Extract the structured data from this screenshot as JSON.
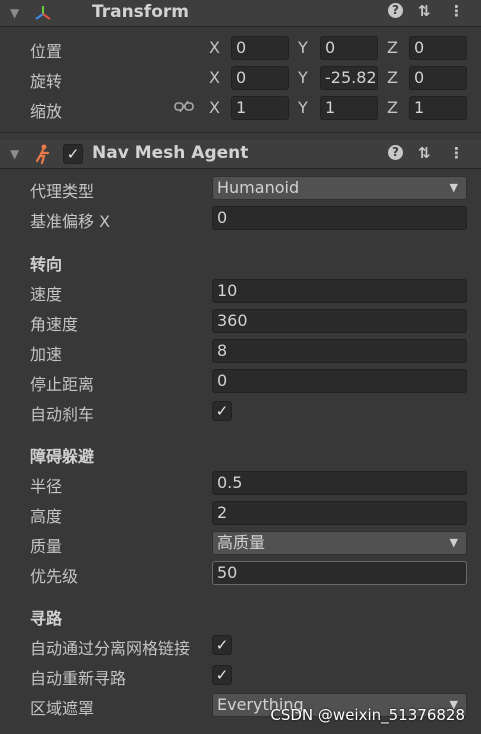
{
  "transform": {
    "title": "Transform",
    "rows": [
      {
        "label": "位置",
        "x": "0",
        "y": "0",
        "z": "0"
      },
      {
        "label": "旋转",
        "x": "0",
        "y": "-25.82",
        "z": "0"
      },
      {
        "label": "缩放",
        "x": "1",
        "y": "1",
        "z": "1"
      }
    ],
    "axis_labels": {
      "x": "X",
      "y": "Y",
      "z": "Z"
    }
  },
  "agent": {
    "title": "Nav Mesh Agent",
    "agent_type_label": "代理类型",
    "agent_type_value": "Humanoid",
    "base_offset_label": "基准偏移 X",
    "base_offset_value": "0",
    "steering": {
      "section_title": "转向",
      "speed_label": "速度",
      "speed_value": "10",
      "angular_speed_label": "角速度",
      "angular_speed_value": "360",
      "acceleration_label": "加速",
      "acceleration_value": "8",
      "stopping_distance_label": "停止距离",
      "stopping_distance_value": "0",
      "auto_braking_label": "自动刹车",
      "auto_braking_checked": "✓"
    },
    "avoidance": {
      "section_title": "障碍躲避",
      "radius_label": "半径",
      "radius_value": "0.5",
      "height_label": "高度",
      "height_value": "2",
      "quality_label": "质量",
      "quality_value": "高质量",
      "priority_label": "优先级",
      "priority_value": "50"
    },
    "pathfinding": {
      "section_title": "寻路",
      "auto_traverse_label": "自动通过分离网格链接",
      "auto_traverse_checked": "✓",
      "auto_repath_label": "自动重新寻路",
      "auto_repath_checked": "✓",
      "area_mask_label": "区域遮罩",
      "area_mask_value": "Everything"
    }
  },
  "icons": {
    "fold": "▼",
    "help": "?",
    "presets": "⇅",
    "more": "⋮",
    "dropdown_arrow": "▼",
    "link": "⛓"
  },
  "watermark": "CSDN @weixin_51376828"
}
